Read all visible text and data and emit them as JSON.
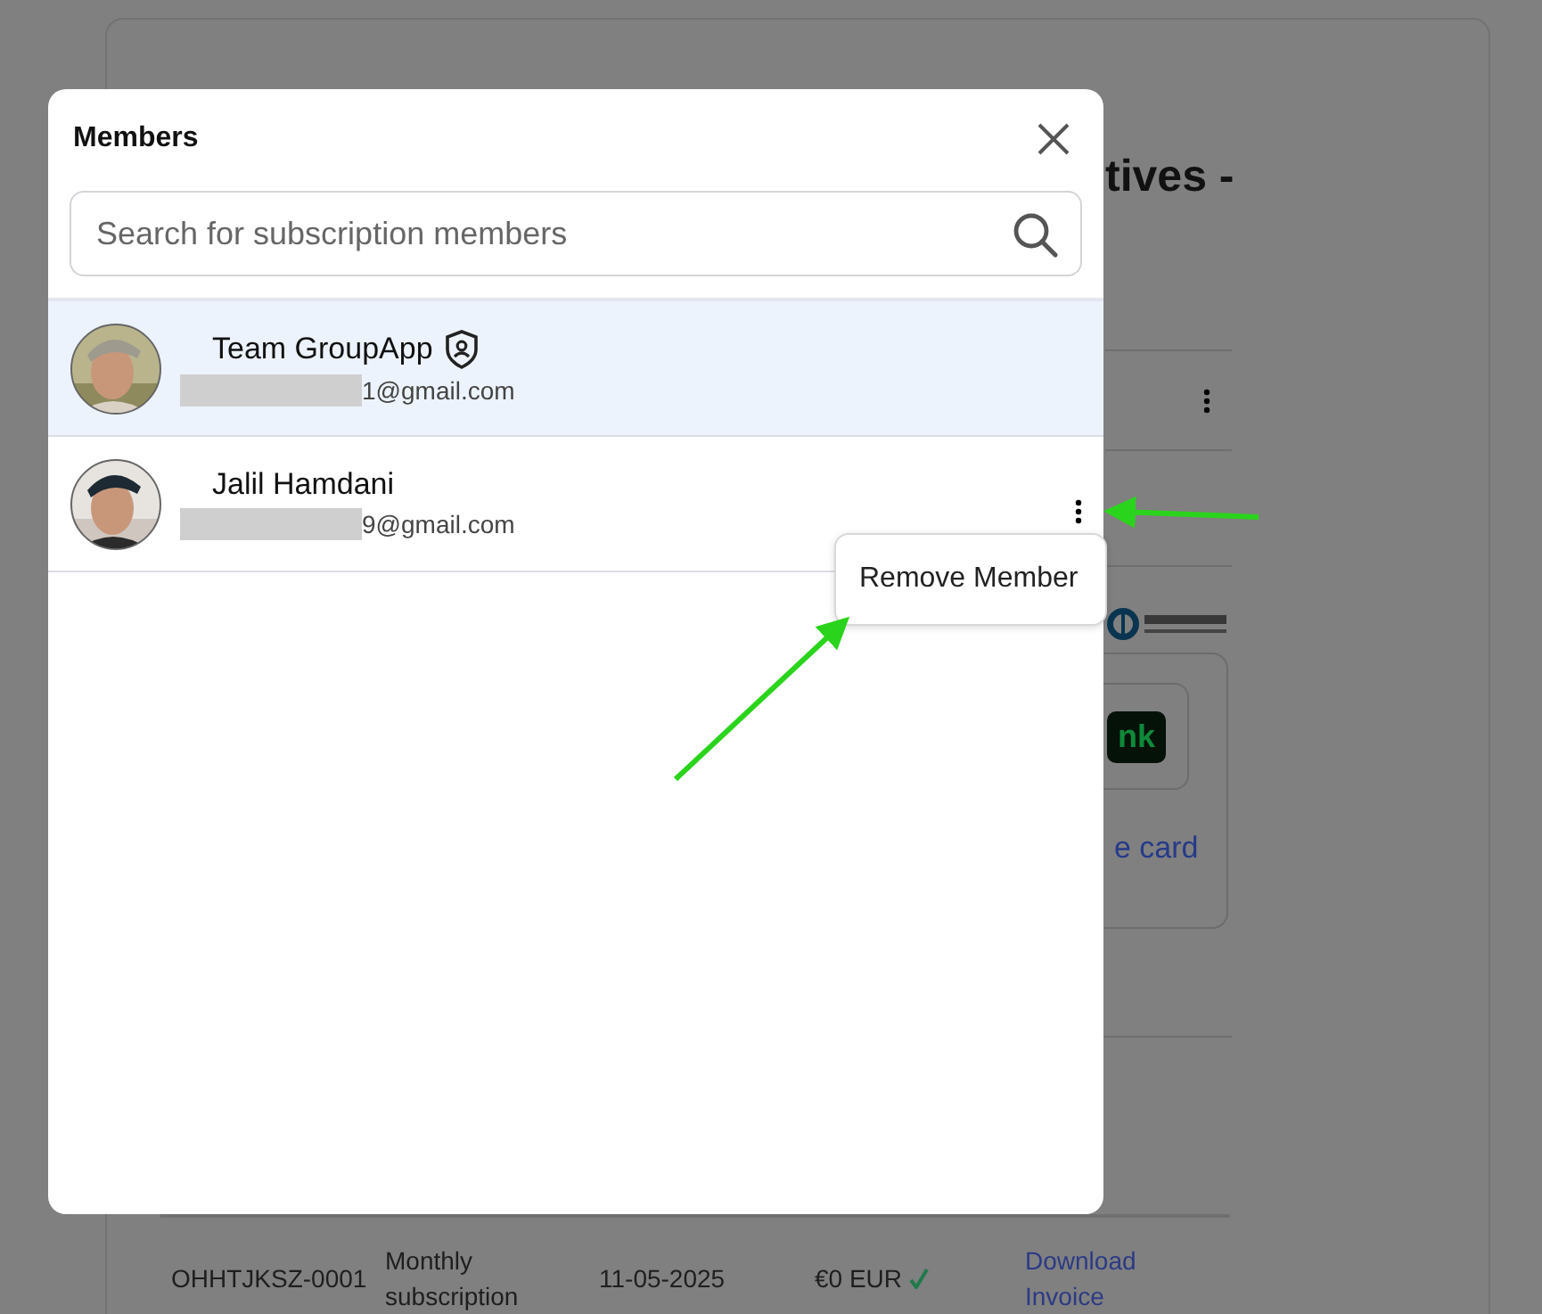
{
  "background_page": {
    "heading": "tives -",
    "badge": "nk",
    "card_link": "e card",
    "table": {
      "rows": [
        {
          "cells": [
            "OHHTJKSZ-0001",
            "Monthly subscription",
            "11-05-2025",
            "€0 EUR",
            "Download Invoice"
          ],
          "paid": true
        }
      ]
    }
  },
  "modal": {
    "title": "Members",
    "search": {
      "placeholder": "Search for subscription members"
    },
    "members": [
      {
        "name": "Team GroupApp",
        "email": "1@gmail.com",
        "redacted": true,
        "admin": true,
        "selected": true,
        "show_actions": false
      },
      {
        "name": "Jalil Hamdani",
        "email": "9@gmail.com",
        "redacted": true,
        "admin": false,
        "selected": false,
        "show_actions": true
      }
    ],
    "context_menu": {
      "items": [
        "Remove Member"
      ]
    }
  }
}
